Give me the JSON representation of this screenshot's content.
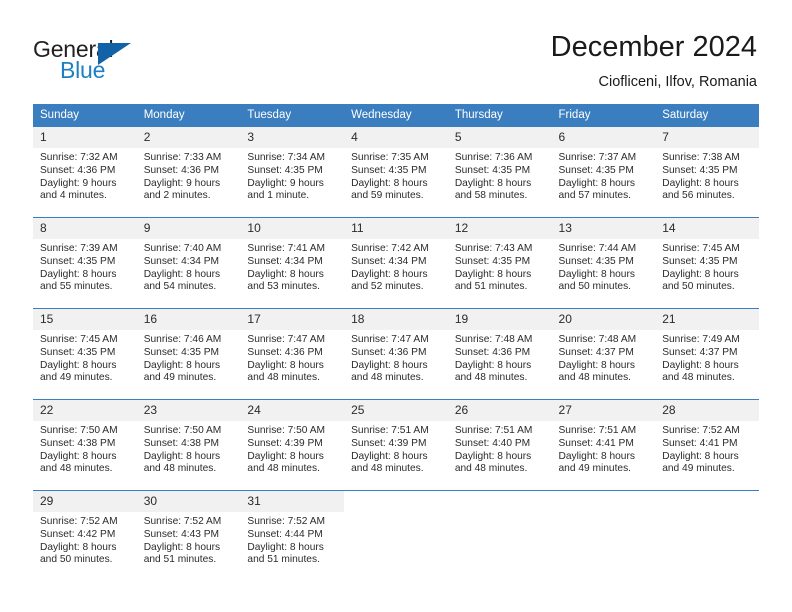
{
  "brand": {
    "name_top": "General",
    "name_bottom": "Blue",
    "accent_color": "#1262a8",
    "text_color": "#231f20"
  },
  "header": {
    "title": "December 2024",
    "subtitle": "Ciofliceni, Ilfov, Romania"
  },
  "theme": {
    "header_bar_color": "#3a7ebf",
    "daynum_band_color": "#f1f1f1",
    "cell_background": "#ffffff",
    "text_color": "#2b2b2b"
  },
  "weekday_headers": [
    "Sunday",
    "Monday",
    "Tuesday",
    "Wednesday",
    "Thursday",
    "Friday",
    "Saturday"
  ],
  "labels": {
    "sunrise_prefix": "Sunrise:",
    "sunset_prefix": "Sunset:",
    "daylight_prefix": "Daylight:"
  },
  "weeks": [
    [
      {
        "day": "1",
        "sunrise": "Sunrise: 7:32 AM",
        "sunset": "Sunset: 4:36 PM",
        "daylight_line1": "Daylight: 9 hours",
        "daylight_line2": "and 4 minutes."
      },
      {
        "day": "2",
        "sunrise": "Sunrise: 7:33 AM",
        "sunset": "Sunset: 4:36 PM",
        "daylight_line1": "Daylight: 9 hours",
        "daylight_line2": "and 2 minutes."
      },
      {
        "day": "3",
        "sunrise": "Sunrise: 7:34 AM",
        "sunset": "Sunset: 4:35 PM",
        "daylight_line1": "Daylight: 9 hours",
        "daylight_line2": "and 1 minute."
      },
      {
        "day": "4",
        "sunrise": "Sunrise: 7:35 AM",
        "sunset": "Sunset: 4:35 PM",
        "daylight_line1": "Daylight: 8 hours",
        "daylight_line2": "and 59 minutes."
      },
      {
        "day": "5",
        "sunrise": "Sunrise: 7:36 AM",
        "sunset": "Sunset: 4:35 PM",
        "daylight_line1": "Daylight: 8 hours",
        "daylight_line2": "and 58 minutes."
      },
      {
        "day": "6",
        "sunrise": "Sunrise: 7:37 AM",
        "sunset": "Sunset: 4:35 PM",
        "daylight_line1": "Daylight: 8 hours",
        "daylight_line2": "and 57 minutes."
      },
      {
        "day": "7",
        "sunrise": "Sunrise: 7:38 AM",
        "sunset": "Sunset: 4:35 PM",
        "daylight_line1": "Daylight: 8 hours",
        "daylight_line2": "and 56 minutes."
      }
    ],
    [
      {
        "day": "8",
        "sunrise": "Sunrise: 7:39 AM",
        "sunset": "Sunset: 4:35 PM",
        "daylight_line1": "Daylight: 8 hours",
        "daylight_line2": "and 55 minutes."
      },
      {
        "day": "9",
        "sunrise": "Sunrise: 7:40 AM",
        "sunset": "Sunset: 4:34 PM",
        "daylight_line1": "Daylight: 8 hours",
        "daylight_line2": "and 54 minutes."
      },
      {
        "day": "10",
        "sunrise": "Sunrise: 7:41 AM",
        "sunset": "Sunset: 4:34 PM",
        "daylight_line1": "Daylight: 8 hours",
        "daylight_line2": "and 53 minutes."
      },
      {
        "day": "11",
        "sunrise": "Sunrise: 7:42 AM",
        "sunset": "Sunset: 4:34 PM",
        "daylight_line1": "Daylight: 8 hours",
        "daylight_line2": "and 52 minutes."
      },
      {
        "day": "12",
        "sunrise": "Sunrise: 7:43 AM",
        "sunset": "Sunset: 4:35 PM",
        "daylight_line1": "Daylight: 8 hours",
        "daylight_line2": "and 51 minutes."
      },
      {
        "day": "13",
        "sunrise": "Sunrise: 7:44 AM",
        "sunset": "Sunset: 4:35 PM",
        "daylight_line1": "Daylight: 8 hours",
        "daylight_line2": "and 50 minutes."
      },
      {
        "day": "14",
        "sunrise": "Sunrise: 7:45 AM",
        "sunset": "Sunset: 4:35 PM",
        "daylight_line1": "Daylight: 8 hours",
        "daylight_line2": "and 50 minutes."
      }
    ],
    [
      {
        "day": "15",
        "sunrise": "Sunrise: 7:45 AM",
        "sunset": "Sunset: 4:35 PM",
        "daylight_line1": "Daylight: 8 hours",
        "daylight_line2": "and 49 minutes."
      },
      {
        "day": "16",
        "sunrise": "Sunrise: 7:46 AM",
        "sunset": "Sunset: 4:35 PM",
        "daylight_line1": "Daylight: 8 hours",
        "daylight_line2": "and 49 minutes."
      },
      {
        "day": "17",
        "sunrise": "Sunrise: 7:47 AM",
        "sunset": "Sunset: 4:36 PM",
        "daylight_line1": "Daylight: 8 hours",
        "daylight_line2": "and 48 minutes."
      },
      {
        "day": "18",
        "sunrise": "Sunrise: 7:47 AM",
        "sunset": "Sunset: 4:36 PM",
        "daylight_line1": "Daylight: 8 hours",
        "daylight_line2": "and 48 minutes."
      },
      {
        "day": "19",
        "sunrise": "Sunrise: 7:48 AM",
        "sunset": "Sunset: 4:36 PM",
        "daylight_line1": "Daylight: 8 hours",
        "daylight_line2": "and 48 minutes."
      },
      {
        "day": "20",
        "sunrise": "Sunrise: 7:48 AM",
        "sunset": "Sunset: 4:37 PM",
        "daylight_line1": "Daylight: 8 hours",
        "daylight_line2": "and 48 minutes."
      },
      {
        "day": "21",
        "sunrise": "Sunrise: 7:49 AM",
        "sunset": "Sunset: 4:37 PM",
        "daylight_line1": "Daylight: 8 hours",
        "daylight_line2": "and 48 minutes."
      }
    ],
    [
      {
        "day": "22",
        "sunrise": "Sunrise: 7:50 AM",
        "sunset": "Sunset: 4:38 PM",
        "daylight_line1": "Daylight: 8 hours",
        "daylight_line2": "and 48 minutes."
      },
      {
        "day": "23",
        "sunrise": "Sunrise: 7:50 AM",
        "sunset": "Sunset: 4:38 PM",
        "daylight_line1": "Daylight: 8 hours",
        "daylight_line2": "and 48 minutes."
      },
      {
        "day": "24",
        "sunrise": "Sunrise: 7:50 AM",
        "sunset": "Sunset: 4:39 PM",
        "daylight_line1": "Daylight: 8 hours",
        "daylight_line2": "and 48 minutes."
      },
      {
        "day": "25",
        "sunrise": "Sunrise: 7:51 AM",
        "sunset": "Sunset: 4:39 PM",
        "daylight_line1": "Daylight: 8 hours",
        "daylight_line2": "and 48 minutes."
      },
      {
        "day": "26",
        "sunrise": "Sunrise: 7:51 AM",
        "sunset": "Sunset: 4:40 PM",
        "daylight_line1": "Daylight: 8 hours",
        "daylight_line2": "and 48 minutes."
      },
      {
        "day": "27",
        "sunrise": "Sunrise: 7:51 AM",
        "sunset": "Sunset: 4:41 PM",
        "daylight_line1": "Daylight: 8 hours",
        "daylight_line2": "and 49 minutes."
      },
      {
        "day": "28",
        "sunrise": "Sunrise: 7:52 AM",
        "sunset": "Sunset: 4:41 PM",
        "daylight_line1": "Daylight: 8 hours",
        "daylight_line2": "and 49 minutes."
      }
    ],
    [
      {
        "day": "29",
        "sunrise": "Sunrise: 7:52 AM",
        "sunset": "Sunset: 4:42 PM",
        "daylight_line1": "Daylight: 8 hours",
        "daylight_line2": "and 50 minutes."
      },
      {
        "day": "30",
        "sunrise": "Sunrise: 7:52 AM",
        "sunset": "Sunset: 4:43 PM",
        "daylight_line1": "Daylight: 8 hours",
        "daylight_line2": "and 51 minutes."
      },
      {
        "day": "31",
        "sunrise": "Sunrise: 7:52 AM",
        "sunset": "Sunset: 4:44 PM",
        "daylight_line1": "Daylight: 8 hours",
        "daylight_line2": "and 51 minutes."
      },
      {
        "day": "",
        "sunrise": "",
        "sunset": "",
        "daylight_line1": "",
        "daylight_line2": ""
      },
      {
        "day": "",
        "sunrise": "",
        "sunset": "",
        "daylight_line1": "",
        "daylight_line2": ""
      },
      {
        "day": "",
        "sunrise": "",
        "sunset": "",
        "daylight_line1": "",
        "daylight_line2": ""
      },
      {
        "day": "",
        "sunrise": "",
        "sunset": "",
        "daylight_line1": "",
        "daylight_line2": ""
      }
    ]
  ]
}
